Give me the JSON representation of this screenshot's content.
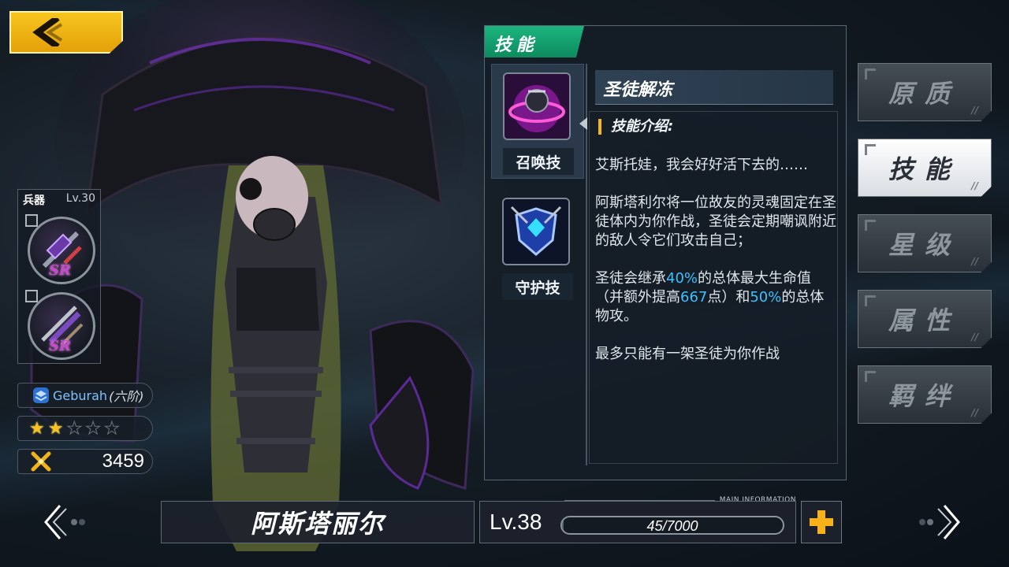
{
  "header": {
    "back_icon": "chevron-left-icon"
  },
  "weapon": {
    "label": "兵器",
    "level": "Lv.30",
    "slots": [
      {
        "rarity": "SR",
        "icon": "weapon-1-icon"
      },
      {
        "rarity": "SR",
        "icon": "weapon-2-icon"
      }
    ]
  },
  "rank": {
    "name": "Geburah",
    "tier": "(六阶)"
  },
  "stars": {
    "filled": 2,
    "total": 5
  },
  "power": {
    "value": "3459"
  },
  "skill_panel": {
    "tab_label": "技能",
    "skills": [
      {
        "name": "召唤技",
        "icon": "summon-skill-icon",
        "selected": true
      },
      {
        "name": "守护技",
        "icon": "guard-skill-icon",
        "selected": false
      }
    ],
    "detail": {
      "title": "圣徒解冻",
      "intro_heading": "技能介绍:",
      "quote": "艾斯托娃，我会好好活下去的……",
      "para1": "阿斯塔利尔将一位故友的灵魂固定在圣徒体内为你作战，圣徒会定期嘲讽附近的敌人令它们攻击自己；",
      "para2_a": "圣徒会继承",
      "para2_pct1": "40%",
      "para2_b": "的总体最大生命值（并额外提高",
      "para2_val": "667",
      "para2_c": "点）和",
      "para2_pct2": "50%",
      "para2_d": "的总体物攻。",
      "para3": "最多只能有一架圣徒为你作战"
    }
  },
  "side_tabs": [
    {
      "label": "原质",
      "active": false
    },
    {
      "label": "技能",
      "active": true
    },
    {
      "label": "星级",
      "active": false
    },
    {
      "label": "属性",
      "active": false
    },
    {
      "label": "羁绊",
      "active": false
    }
  ],
  "character": {
    "name": "阿斯塔丽尔",
    "level": "Lv.38",
    "exp_text": "45/7000",
    "exp_fraction": 0.0064,
    "main_info": "MAIN INFORMATION"
  },
  "colors": {
    "accent_yellow": "#f7c21d",
    "tab_green": "#1bb57f",
    "highlight_blue": "#3ec0ff"
  }
}
